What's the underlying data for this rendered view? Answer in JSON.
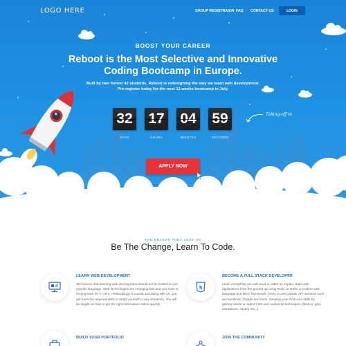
{
  "header": {
    "logo": "LOGO HERE",
    "nav": [
      {
        "label": "GROUP REGISTRAION"
      },
      {
        "label": "FAQ"
      },
      {
        "label": "CONTACT US"
      }
    ],
    "login_label": "LOGIN"
  },
  "hero": {
    "eyebrow": "BOOST YOUR CAREER",
    "headline_line1": "Reboot is the Most Selective and Innovative",
    "headline_line2": "Coding Bootcamp in Europe.",
    "sub_line1": "Built by two former 42 students, Reboot is redesigning the way we learn web development.",
    "sub_line2": "Pre-register today for the next 12 weeks bootcamp in July.",
    "countdown": [
      {
        "value": "32",
        "label": "DAYS"
      },
      {
        "value": "17",
        "label": "HOURS"
      },
      {
        "value": "04",
        "label": "MINUTES"
      },
      {
        "value": "59",
        "label": "SECONDS"
      }
    ],
    "takeoff": "Taking-off in",
    "cta": "APPLY NOW",
    "colors": {
      "background": "#1f8fe0",
      "cta": "#e8323a",
      "login": "#0a5fb4"
    }
  },
  "reasons": {
    "eyebrow": "THE REASON THEY LOVE US",
    "title": "Be The Change, Learn To Code.",
    "features": [
      {
        "icon": "monitor-icon",
        "title": "LEARN WEB-DEVELOPMENT",
        "text": "We believe that learning web development should not be limited to one specific language. Web technologies are changing fast and you have to be prepared for it. Here, methodology is crucial and along with us, you will have the required skills to adapt yourself to any situations. You will be taught on how to get the right information online quickly."
      },
      {
        "icon": "html5-icon",
        "title": "BECOME A FULL STACK DEVELOPER",
        "text": "Learn everything you will need to make an impact. Build web applications from the ground up using Ruby on Rails, a modern web language and MVC framework. Learn to use popular API services such as Facebook, Google and more. Develop your front-end skills by getting hands on latest CSS and Javascript techniques (flexbox, grid, animations, Jquery etc...)."
      },
      {
        "icon": "portfolio-icon",
        "title": "BUILD YOUR PORTFOLIO",
        "text": ""
      },
      {
        "icon": "community-icon",
        "title": "JOIN THE COMMUNITY",
        "text": ""
      }
    ]
  }
}
